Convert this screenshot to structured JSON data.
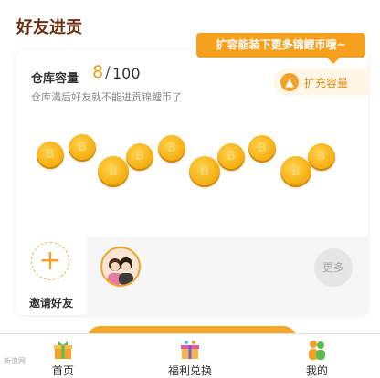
{
  "section": {
    "title": "好友进贡"
  },
  "tooltip": {
    "text": "扩容能装下更多锦鲤币哦~"
  },
  "capacity": {
    "label": "仓库容量",
    "used": "8",
    "separator": "/",
    "total": "100",
    "hint": "仓库满后好友就不能进贡锦鲤币了",
    "expand_label": "扩充容量"
  },
  "coins": {
    "count": 8,
    "icon": "koi-coin-icon"
  },
  "friends": {
    "invite_label": "邀请好友",
    "more_label": "更多"
  },
  "tabs": [
    {
      "label": "首页",
      "icon": "home-gift-icon"
    },
    {
      "label": "福利兑换",
      "icon": "gift-box-icon"
    },
    {
      "label": "我的",
      "icon": "people-icon"
    }
  ],
  "watermark": "新浪网",
  "colors": {
    "accent": "#f6a01d",
    "title": "#6b2f12"
  }
}
